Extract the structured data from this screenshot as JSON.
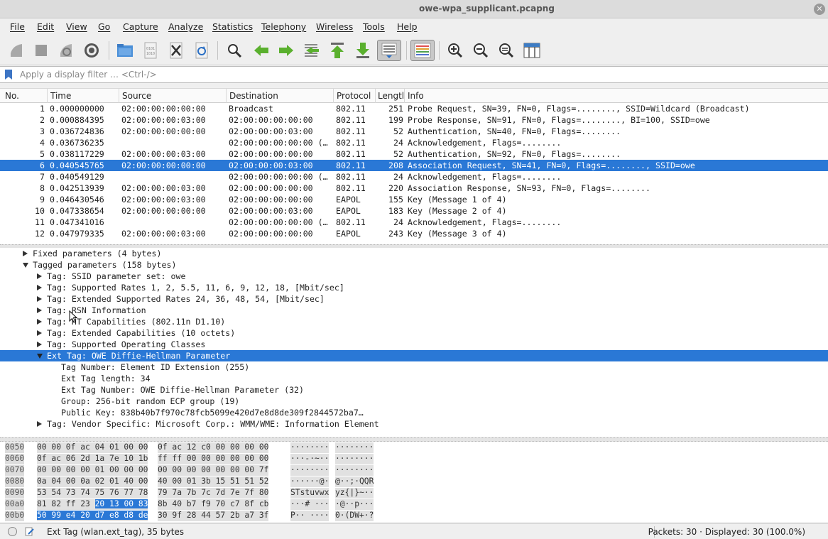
{
  "window": {
    "title": "owe-wpa_supplicant.pcapng"
  },
  "menu": [
    "File",
    "Edit",
    "View",
    "Go",
    "Capture",
    "Analyze",
    "Statistics",
    "Telephony",
    "Wireless",
    "Tools",
    "Help"
  ],
  "filter": {
    "placeholder": "Apply a display filter … <Ctrl-/>"
  },
  "columns": [
    "No.",
    "Time",
    "Source",
    "Destination",
    "Protocol",
    "Lengtl",
    "Info"
  ],
  "packets": [
    {
      "no": "1",
      "time": "0.000000000",
      "src": "02:00:00:00:00:00",
      "dst": "Broadcast",
      "proto": "802.11",
      "len": "251",
      "info": "Probe Request, SN=39, FN=0, Flags=........, SSID=Wildcard (Broadcast)"
    },
    {
      "no": "2",
      "time": "0.000884395",
      "src": "02:00:00:00:03:00",
      "dst": "02:00:00:00:00:00",
      "proto": "802.11",
      "len": "199",
      "info": "Probe Response, SN=91, FN=0, Flags=........, BI=100, SSID=owe"
    },
    {
      "no": "3",
      "time": "0.036724836",
      "src": "02:00:00:00:00:00",
      "dst": "02:00:00:00:03:00",
      "proto": "802.11",
      "len": "52",
      "info": "Authentication, SN=40, FN=0, Flags=........"
    },
    {
      "no": "4",
      "time": "0.036736235",
      "src": "",
      "dst": "02:00:00:00:00:00 (…",
      "proto": "802.11",
      "len": "24",
      "info": "Acknowledgement, Flags=........"
    },
    {
      "no": "5",
      "time": "0.038117229",
      "src": "02:00:00:00:03:00",
      "dst": "02:00:00:00:00:00",
      "proto": "802.11",
      "len": "52",
      "info": "Authentication, SN=92, FN=0, Flags=........"
    },
    {
      "no": "6",
      "time": "0.040545765",
      "src": "02:00:00:00:00:00",
      "dst": "02:00:00:00:03:00",
      "proto": "802.11",
      "len": "208",
      "info": "Association Request, SN=41, FN=0, Flags=........, SSID=owe"
    },
    {
      "no": "7",
      "time": "0.040549129",
      "src": "",
      "dst": "02:00:00:00:00:00 (…",
      "proto": "802.11",
      "len": "24",
      "info": "Acknowledgement, Flags=........"
    },
    {
      "no": "8",
      "time": "0.042513939",
      "src": "02:00:00:00:03:00",
      "dst": "02:00:00:00:00:00",
      "proto": "802.11",
      "len": "220",
      "info": "Association Response, SN=93, FN=0, Flags=........"
    },
    {
      "no": "9",
      "time": "0.046430546",
      "src": "02:00:00:00:03:00",
      "dst": "02:00:00:00:00:00",
      "proto": "EAPOL",
      "len": "155",
      "info": "Key (Message 1 of 4)"
    },
    {
      "no": "10",
      "time": "0.047338654",
      "src": "02:00:00:00:00:00",
      "dst": "02:00:00:00:03:00",
      "proto": "EAPOL",
      "len": "183",
      "info": "Key (Message 2 of 4)"
    },
    {
      "no": "11",
      "time": "0.047341016",
      "src": "",
      "dst": "02:00:00:00:00:00 (…",
      "proto": "802.11",
      "len": "24",
      "info": "Acknowledgement, Flags=........"
    },
    {
      "no": "12",
      "time": "0.047979335",
      "src": "02:00:00:00:03:00",
      "dst": "02:00:00:00:00:00",
      "proto": "EAPOL",
      "len": "243",
      "info": "Key (Message 3 of 4)"
    }
  ],
  "details": [
    {
      "indent": 0,
      "state": "closed",
      "text": "Fixed parameters (4 bytes)"
    },
    {
      "indent": 0,
      "state": "open",
      "text": "Tagged parameters (158 bytes)"
    },
    {
      "indent": 1,
      "state": "closed",
      "text": "Tag: SSID parameter set: owe"
    },
    {
      "indent": 1,
      "state": "closed",
      "text": "Tag: Supported Rates 1, 2, 5.5, 11, 6, 9, 12, 18, [Mbit/sec]"
    },
    {
      "indent": 1,
      "state": "closed",
      "text": "Tag: Extended Supported Rates 24, 36, 48, 54, [Mbit/sec]"
    },
    {
      "indent": 1,
      "state": "closed",
      "text": "Tag: RSN Information"
    },
    {
      "indent": 1,
      "state": "closed",
      "text": "Tag: HT Capabilities (802.11n D1.10)"
    },
    {
      "indent": 1,
      "state": "closed",
      "text": "Tag: Extended Capabilities (10 octets)"
    },
    {
      "indent": 1,
      "state": "closed",
      "text": "Tag: Supported Operating Classes"
    },
    {
      "indent": 1,
      "state": "open",
      "text": "Ext Tag: OWE Diffie-Hellman Parameter"
    },
    {
      "indent": 2,
      "state": "leaf",
      "text": "Tag Number: Element ID Extension (255)"
    },
    {
      "indent": 2,
      "state": "leaf",
      "text": "Ext Tag length: 34"
    },
    {
      "indent": 2,
      "state": "leaf",
      "text": "Ext Tag Number: OWE Diffie-Hellman Parameter (32)"
    },
    {
      "indent": 2,
      "state": "leaf",
      "text": "Group: 256-bit random ECP group (19)"
    },
    {
      "indent": 2,
      "state": "leaf",
      "text": "Public Key: 838b40b7f970c78fcb5099e420d7e8d8de309f2844572ba7…"
    },
    {
      "indent": 1,
      "state": "closed",
      "text": "Tag: Vendor Specific: Microsoft Corp.: WMM/WME: Information Element"
    }
  ],
  "bytes": [
    {
      "off": "0050",
      "h1": "00 00 0f ac 04 01 00 00",
      "h2": "0f ac 12 c0 00 00 00 00",
      "a1": "········",
      "a2": "········"
    },
    {
      "off": "0060",
      "h1": "0f ac 06 2d 1a 7e 10 1b",
      "h2": "ff ff 00 00 00 00 00 00",
      "a1": "···-·~··",
      "a2": "········"
    },
    {
      "off": "0070",
      "h1": "00 00 00 00 01 00 00 00",
      "h2": "00 00 00 00 00 00 00 7f",
      "a1": "········",
      "a2": "········"
    },
    {
      "off": "0080",
      "h1": "0a 04 00 0a 02 01 40 00",
      "h2": "40 00 01 3b 15 51 51 52",
      "a1": "······@·",
      "a2": "@··;·QQR"
    },
    {
      "off": "0090",
      "h1": "53 54 73 74 75 76 77 78",
      "h2": "79 7a 7b 7c 7d 7e 7f 80",
      "a1": "STstuvwx",
      "a2": "yz{|}~··"
    },
    {
      "off": "00a0",
      "h1": "81 82 ff 23 20 13 00 83",
      "h2": "8b 40 b7 f9 70 c7 8f cb",
      "a1": "···# ···",
      "a2": "·@··p···"
    },
    {
      "off": "00b0",
      "h1": "50 99 e4 20 d7 e8 d8 de",
      "h2": "30 9f 28 44 57 2b a7 3f",
      "a1": "P·· ····",
      "a2": "0·(DW+·?"
    },
    {
      "off": "00c0",
      "h1": "ff 1d ea 24 b5 29 2f dd",
      "h2": "07 00 50 f2 02 00 01 00",
      "a1": "···$·)/·",
      "a2": "··P·····"
    }
  ],
  "status": {
    "left": "Ext Tag (wlan.ext_tag), 35 bytes",
    "right": "Packets: 30 · Displayed: 30 (100.0%)"
  }
}
